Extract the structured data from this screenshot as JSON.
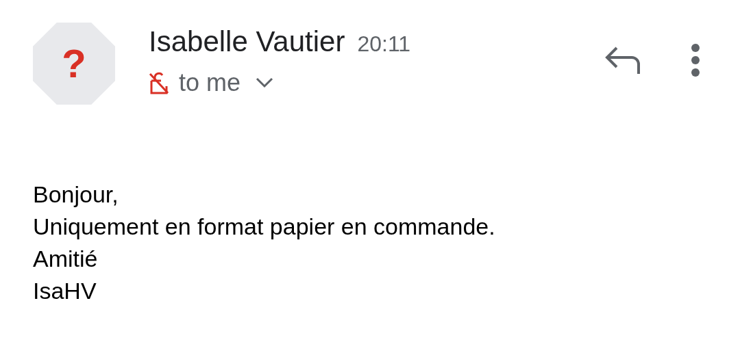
{
  "message": {
    "avatar": {
      "text": "?"
    },
    "sender": "Isabelle Vautier",
    "time": "20:11",
    "encrypted": false,
    "recipients": "to me",
    "details_expanded": false,
    "body": [
      "Bonjour,",
      "Uniquement en format papier en commande.",
      "Amitié",
      "IsaHV"
    ]
  }
}
